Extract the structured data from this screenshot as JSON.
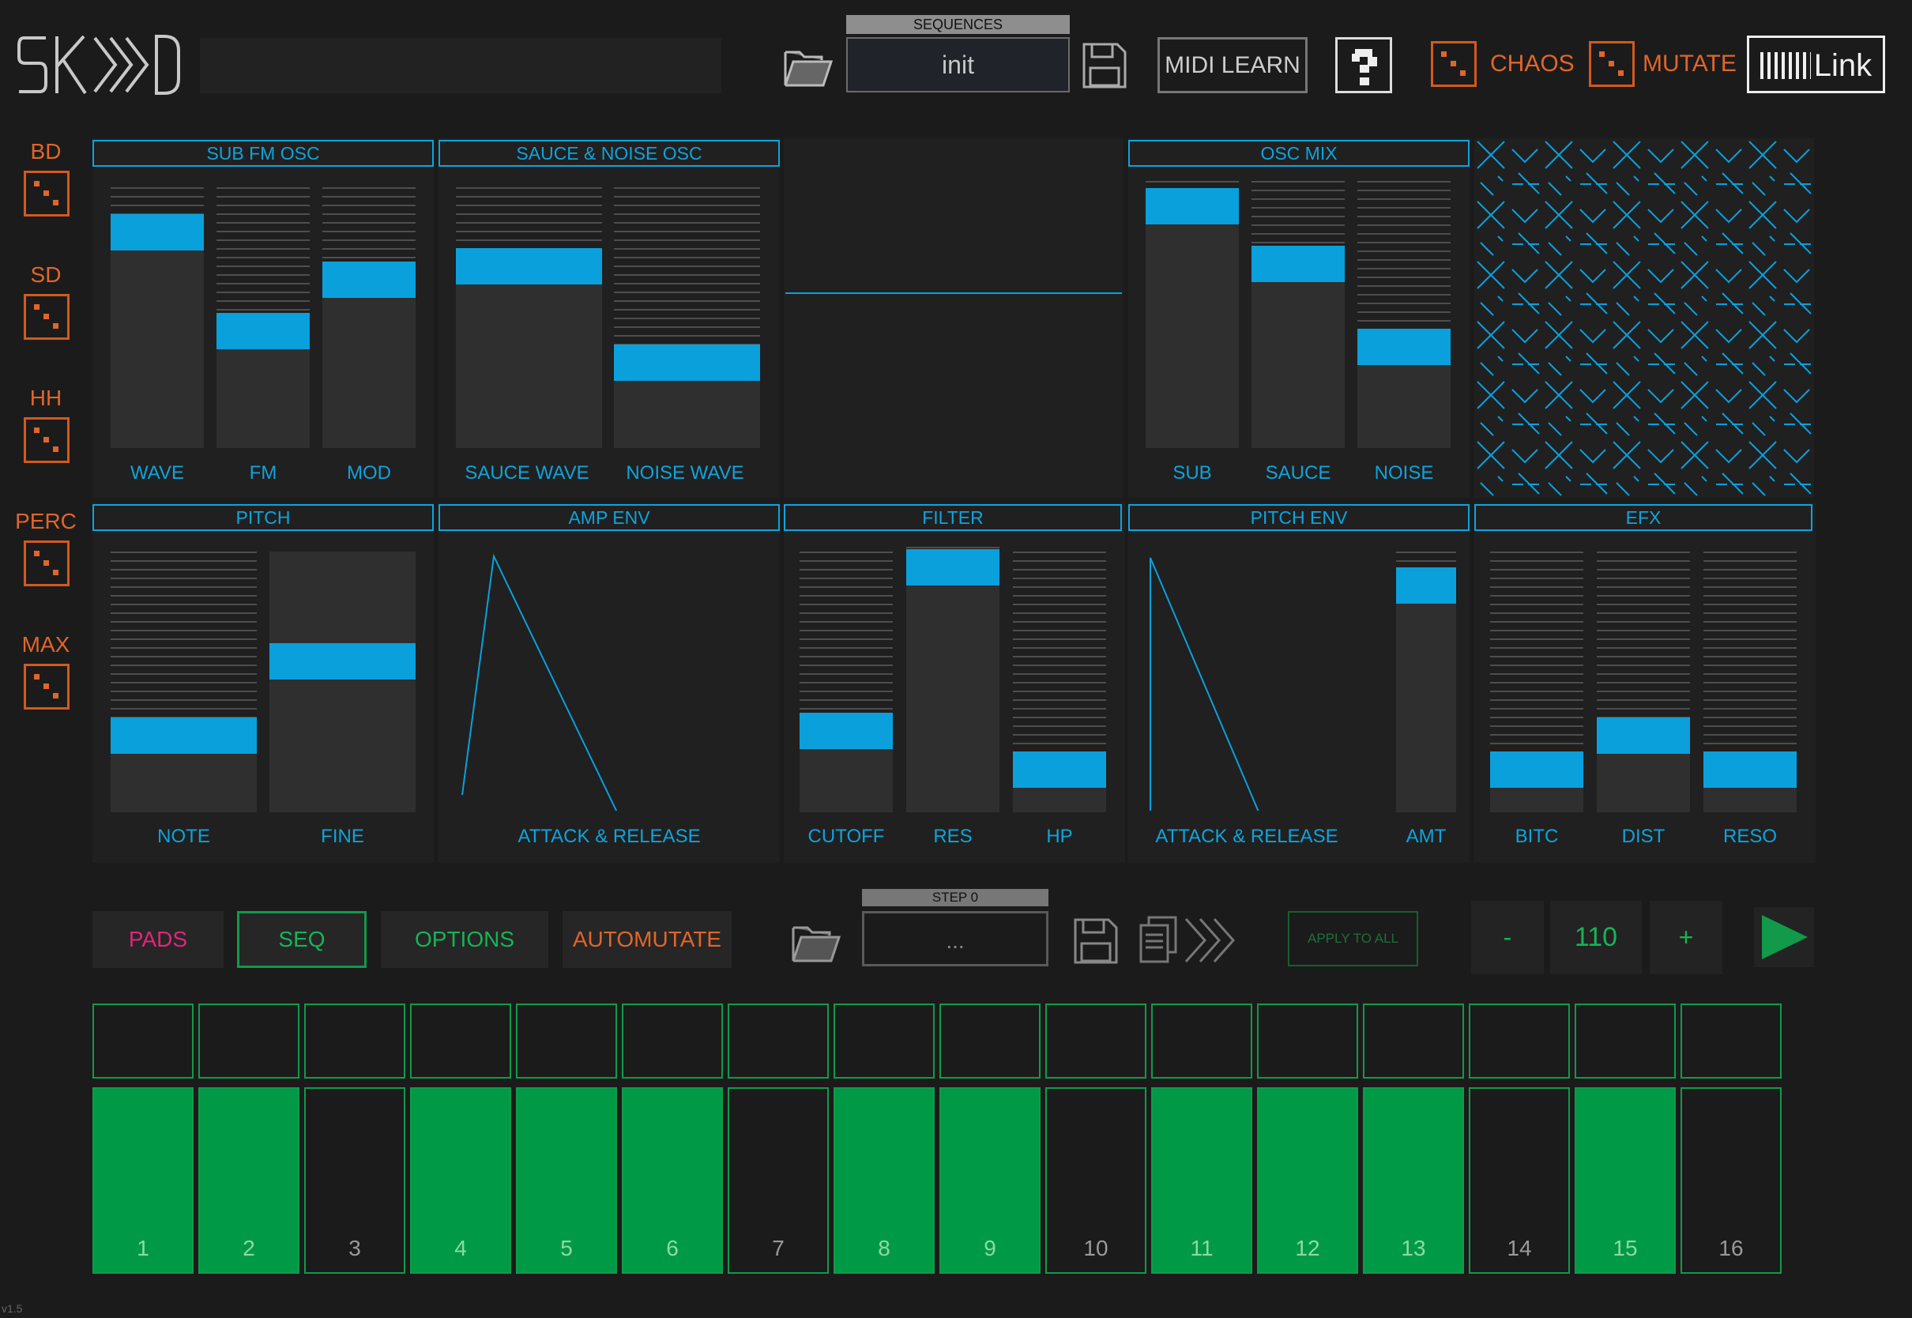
{
  "app": {
    "logo_text": "SK>>>D",
    "version": "v1.5"
  },
  "header": {
    "sequences_label": "SEQUENCES",
    "sequence_name": "init",
    "midi_learn_label": "MIDI LEARN",
    "chaos_label": "CHAOS",
    "mutate_label": "MUTATE",
    "link_label": "Link"
  },
  "instruments": [
    "BD",
    "SD",
    "HH",
    "PERC",
    "MAX"
  ],
  "panels": {
    "sub_fm_osc": {
      "title": "SUB FM OSC",
      "labels": [
        "WAVE",
        "FM",
        "MOD"
      ],
      "levels": [
        0.88,
        0.44,
        0.67
      ]
    },
    "sauce_noise_osc": {
      "title": "SAUCE & NOISE OSC",
      "labels": [
        "SAUCE WAVE",
        "NOISE WAVE"
      ],
      "levels": [
        0.73,
        0.3
      ]
    },
    "osc_mix": {
      "title": "OSC MIX",
      "labels": [
        "SUB",
        "SAUCE",
        "NOISE"
      ],
      "levels": [
        0.97,
        0.72,
        0.36
      ]
    },
    "pitch": {
      "title": "PITCH",
      "labels": [
        "NOTE",
        "FINE"
      ],
      "levels": [
        0.26,
        0.59
      ]
    },
    "amp_env": {
      "title": "AMP ENV",
      "label": "ATTACK & RELEASE"
    },
    "filter": {
      "title": "FILTER",
      "labels": [
        "CUTOFF",
        "RES",
        "HP"
      ],
      "levels": [
        0.28,
        0.99,
        0.11
      ]
    },
    "pitch_env": {
      "title": "PITCH ENV",
      "labels": [
        "ATTACK & RELEASE",
        "AMT"
      ],
      "amt_level": 0.93
    },
    "efx": {
      "title": "EFX",
      "labels": [
        "BITC",
        "DIST",
        "RESO"
      ],
      "levels": [
        0.11,
        0.26,
        0.11
      ]
    }
  },
  "tabs": {
    "pads": "PADS",
    "seq": "SEQ",
    "options": "OPTIONS",
    "automutate": "AUTOMUTATE"
  },
  "step_panel": {
    "step_label": "STEP 0",
    "step_value": "...",
    "apply_label": "APPLY TO ALL"
  },
  "tempo": {
    "minus": "-",
    "value": "110",
    "plus": "+"
  },
  "colors": {
    "accent_blue": "#0aa0dc",
    "orange": "#e0662a",
    "green": "#009a47",
    "pink": "#e0267a"
  },
  "steps": [
    {
      "n": "1",
      "on": true
    },
    {
      "n": "2",
      "on": true
    },
    {
      "n": "3",
      "on": false
    },
    {
      "n": "4",
      "on": true
    },
    {
      "n": "5",
      "on": true
    },
    {
      "n": "6",
      "on": true
    },
    {
      "n": "7",
      "on": false
    },
    {
      "n": "8",
      "on": true
    },
    {
      "n": "9",
      "on": true
    },
    {
      "n": "10",
      "on": false
    },
    {
      "n": "11",
      "on": true
    },
    {
      "n": "12",
      "on": true
    },
    {
      "n": "13",
      "on": true
    },
    {
      "n": "14",
      "on": false
    },
    {
      "n": "15",
      "on": true
    },
    {
      "n": "16",
      "on": false
    }
  ]
}
